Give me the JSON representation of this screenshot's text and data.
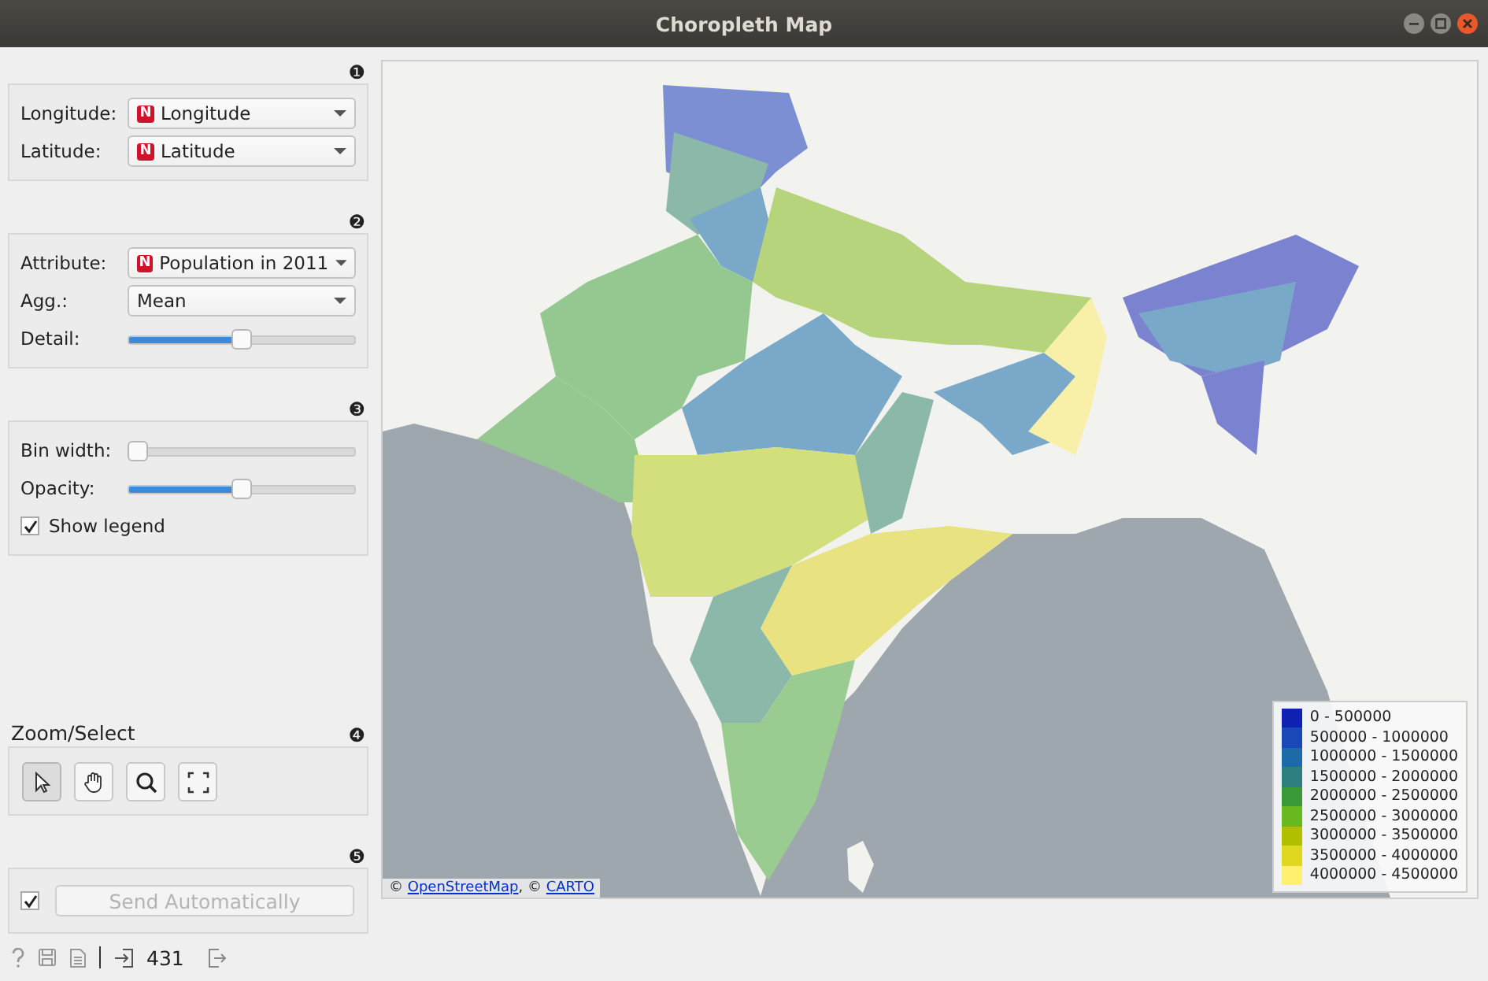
{
  "window": {
    "title": "Choropleth Map"
  },
  "sections": [
    {
      "badge": "❶",
      "controls": [
        {
          "kind": "combo",
          "label": "Longitude:",
          "value": "Longitude",
          "type_badge": "N"
        },
        {
          "kind": "combo",
          "label": "Latitude:",
          "value": "Latitude",
          "type_badge": "N"
        }
      ]
    },
    {
      "badge": "❷",
      "controls": [
        {
          "kind": "combo",
          "label": "Attribute:",
          "value": "Population in 2011",
          "type_badge": "N"
        },
        {
          "kind": "combo",
          "label": "Agg.:",
          "value": "Mean"
        },
        {
          "kind": "slider",
          "label": "Detail:",
          "level": 0.5
        }
      ]
    },
    {
      "badge": "❸",
      "controls": [
        {
          "kind": "slider",
          "label": "Bin width:",
          "level": 0
        },
        {
          "kind": "slider",
          "label": "Opacity:",
          "level": 0.5
        },
        {
          "kind": "checkbox",
          "label": "Show legend",
          "checked": true
        }
      ]
    },
    {
      "title": "Zoom/Select",
      "badge": "❹",
      "tools": [
        {
          "kind": "select",
          "selected": true
        },
        {
          "kind": "pan",
          "selected": false
        },
        {
          "kind": "zoom",
          "selected": false
        },
        {
          "kind": "fit",
          "selected": false
        }
      ]
    },
    {
      "badge": "❺",
      "send": {
        "checked": true,
        "label": "Send Automatically",
        "disabled": true
      }
    }
  ],
  "map": {
    "legend": [
      {
        "label": "0 - 500000",
        "color": "#1020b0"
      },
      {
        "label": "500000 - 1000000",
        "color": "#1a48b8"
      },
      {
        "label": "1000000 - 1500000",
        "color": "#1d6aa8"
      },
      {
        "label": "1500000 - 2000000",
        "color": "#2e8080"
      },
      {
        "label": "2000000 - 2500000",
        "color": "#3a9a3a"
      },
      {
        "label": "2500000 - 3000000",
        "color": "#6ab820"
      },
      {
        "label": "3000000 - 3500000",
        "color": "#b0c000"
      },
      {
        "label": "3500000 - 4000000",
        "color": "#e0d820"
      },
      {
        "label": "4000000 - 4500000",
        "color": "#fff070"
      }
    ],
    "attribution": [
      {
        "kind": "text",
        "text": "© "
      },
      {
        "kind": "link",
        "text": "OpenStreetMap"
      },
      {
        "kind": "text",
        "text": ", © "
      },
      {
        "kind": "link",
        "text": "CARTO"
      }
    ]
  },
  "status_bar": {
    "count": "431"
  }
}
